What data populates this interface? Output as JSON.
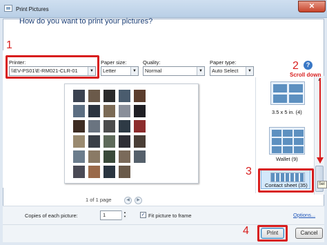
{
  "window": {
    "title": "Print Pictures",
    "close_label": "✕"
  },
  "header": {
    "question": "How do you want to print your pictures?"
  },
  "options": {
    "printer": {
      "label": "Printer:",
      "value": "\\\\EV-PS01\\E-RM021-CLR-01"
    },
    "paper_size": {
      "label": "Paper size:",
      "value": "Letter"
    },
    "quality": {
      "label": "Quality:",
      "value": "Normal"
    },
    "paper_type": {
      "label": "Paper type:",
      "value": "Auto Select"
    }
  },
  "preview": {
    "page_status": "1 of 1 page"
  },
  "layouts": [
    {
      "label": "3.5 x 5 in. (4)"
    },
    {
      "label": "Wallet (9)"
    },
    {
      "label": "Contact sheet (35)"
    }
  ],
  "tooltip_text": "Sel",
  "bottom": {
    "copies_label": "Copies of each picture:",
    "copies_value": "1",
    "fit_label": "Fit picture to frame",
    "options_link": "Options...",
    "print_button": "Print",
    "cancel_button": "Cancel"
  },
  "annotations": {
    "step1": "1",
    "step2": "2",
    "step3": "3",
    "step4": "4",
    "scroll_hint": "Scroll down",
    "help_mark": "?"
  },
  "colors": {
    "annotation_red": "#d81d1d",
    "link_blue": "#1f55b8",
    "question_blue": "#1c3f76"
  }
}
